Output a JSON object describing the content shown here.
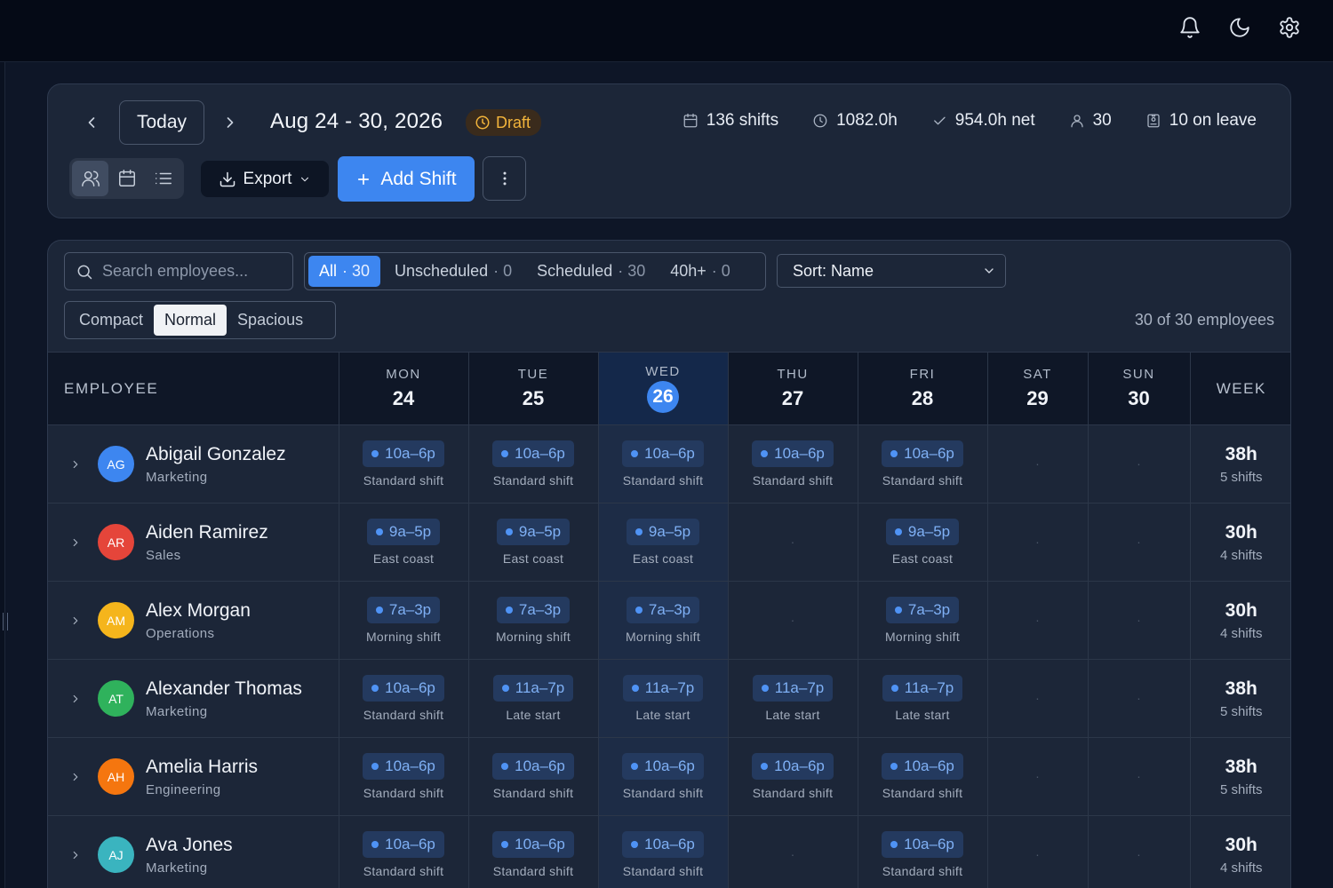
{
  "topbar": {
    "icons": [
      "bell-icon",
      "moon-icon",
      "gear-icon"
    ]
  },
  "toolbar": {
    "today_label": "Today",
    "date_range": "Aug 24 - 30, 2026",
    "status_badge": "Draft",
    "stats": {
      "shifts": "136 shifts",
      "hours": "1082.0h",
      "net": "954.0h net",
      "people": "30",
      "leave": "10 on leave"
    },
    "export_label": "Export",
    "add_shift_label": "Add Shift"
  },
  "filters": {
    "search_placeholder": "Search employees...",
    "tabs": [
      {
        "label": "All",
        "count": "· 30"
      },
      {
        "label": "Unscheduled",
        "count": "· 0"
      },
      {
        "label": "Scheduled",
        "count": "· 30"
      },
      {
        "label": "40h+",
        "count": "· 0"
      }
    ],
    "sort_label": "Sort: Name",
    "density": [
      "Compact",
      "Normal",
      "Spacious"
    ],
    "employee_count": "30 of 30 employees"
  },
  "grid": {
    "employee_header": "EMPLOYEE",
    "week_header": "WEEK",
    "days": [
      {
        "name": "MON",
        "num": "24"
      },
      {
        "name": "TUE",
        "num": "25"
      },
      {
        "name": "WED",
        "num": "26"
      },
      {
        "name": "THU",
        "num": "27"
      },
      {
        "name": "FRI",
        "num": "28"
      },
      {
        "name": "SAT",
        "num": "29"
      },
      {
        "name": "SUN",
        "num": "30"
      }
    ],
    "empty_cell": "·"
  },
  "employees": [
    {
      "initials": "AG",
      "name": "Abigail Gonzalez",
      "dept": "Marketing",
      "avatar_color": "#3d86f0",
      "shifts": [
        {
          "time": "10a–6p",
          "label": "Standard shift"
        },
        {
          "time": "10a–6p",
          "label": "Standard shift"
        },
        {
          "time": "10a–6p",
          "label": "Standard shift"
        },
        {
          "time": "10a–6p",
          "label": "Standard shift"
        },
        {
          "time": "10a–6p",
          "label": "Standard shift"
        },
        null,
        null
      ],
      "week_hours": "38h",
      "week_shifts": "5 shifts"
    },
    {
      "initials": "AR",
      "name": "Aiden Ramirez",
      "dept": "Sales",
      "avatar_color": "#e5453a",
      "shifts": [
        {
          "time": "9a–5p",
          "label": "East coast"
        },
        {
          "time": "9a–5p",
          "label": "East coast"
        },
        {
          "time": "9a–5p",
          "label": "East coast"
        },
        null,
        {
          "time": "9a–5p",
          "label": "East coast"
        },
        null,
        null
      ],
      "week_hours": "30h",
      "week_shifts": "4 shifts"
    },
    {
      "initials": "AM",
      "name": "Alex Morgan",
      "dept": "Operations",
      "avatar_color": "#f5b51c",
      "shifts": [
        {
          "time": "7a–3p",
          "label": "Morning shift"
        },
        {
          "time": "7a–3p",
          "label": "Morning shift"
        },
        {
          "time": "7a–3p",
          "label": "Morning shift"
        },
        null,
        {
          "time": "7a–3p",
          "label": "Morning shift"
        },
        null,
        null
      ],
      "week_hours": "30h",
      "week_shifts": "4 shifts"
    },
    {
      "initials": "AT",
      "name": "Alexander Thomas",
      "dept": "Marketing",
      "avatar_color": "#2fb25c",
      "shifts": [
        {
          "time": "10a–6p",
          "label": "Standard shift"
        },
        {
          "time": "11a–7p",
          "label": "Late start"
        },
        {
          "time": "11a–7p",
          "label": "Late start"
        },
        {
          "time": "11a–7p",
          "label": "Late start"
        },
        {
          "time": "11a–7p",
          "label": "Late start"
        },
        null,
        null
      ],
      "week_hours": "38h",
      "week_shifts": "5 shifts"
    },
    {
      "initials": "AH",
      "name": "Amelia Harris",
      "dept": "Engineering",
      "avatar_color": "#f5760f",
      "shifts": [
        {
          "time": "10a–6p",
          "label": "Standard shift"
        },
        {
          "time": "10a–6p",
          "label": "Standard shift"
        },
        {
          "time": "10a–6p",
          "label": "Standard shift"
        },
        {
          "time": "10a–6p",
          "label": "Standard shift"
        },
        {
          "time": "10a–6p",
          "label": "Standard shift"
        },
        null,
        null
      ],
      "week_hours": "38h",
      "week_shifts": "5 shifts"
    },
    {
      "initials": "AJ",
      "name": "Ava Jones",
      "dept": "Marketing",
      "avatar_color": "#3ab4bf",
      "shifts": [
        {
          "time": "10a–6p",
          "label": "Standard shift"
        },
        {
          "time": "10a–6p",
          "label": "Standard shift"
        },
        {
          "time": "10a–6p",
          "label": "Standard shift"
        },
        null,
        {
          "time": "10a–6p",
          "label": "Standard shift"
        },
        null,
        null
      ],
      "week_hours": "30h",
      "week_shifts": "4 shifts"
    }
  ],
  "colors": {
    "accent": "#3d86f0",
    "draft": "#f2b43b",
    "background": "#0e1627",
    "card": "#1c2638"
  }
}
